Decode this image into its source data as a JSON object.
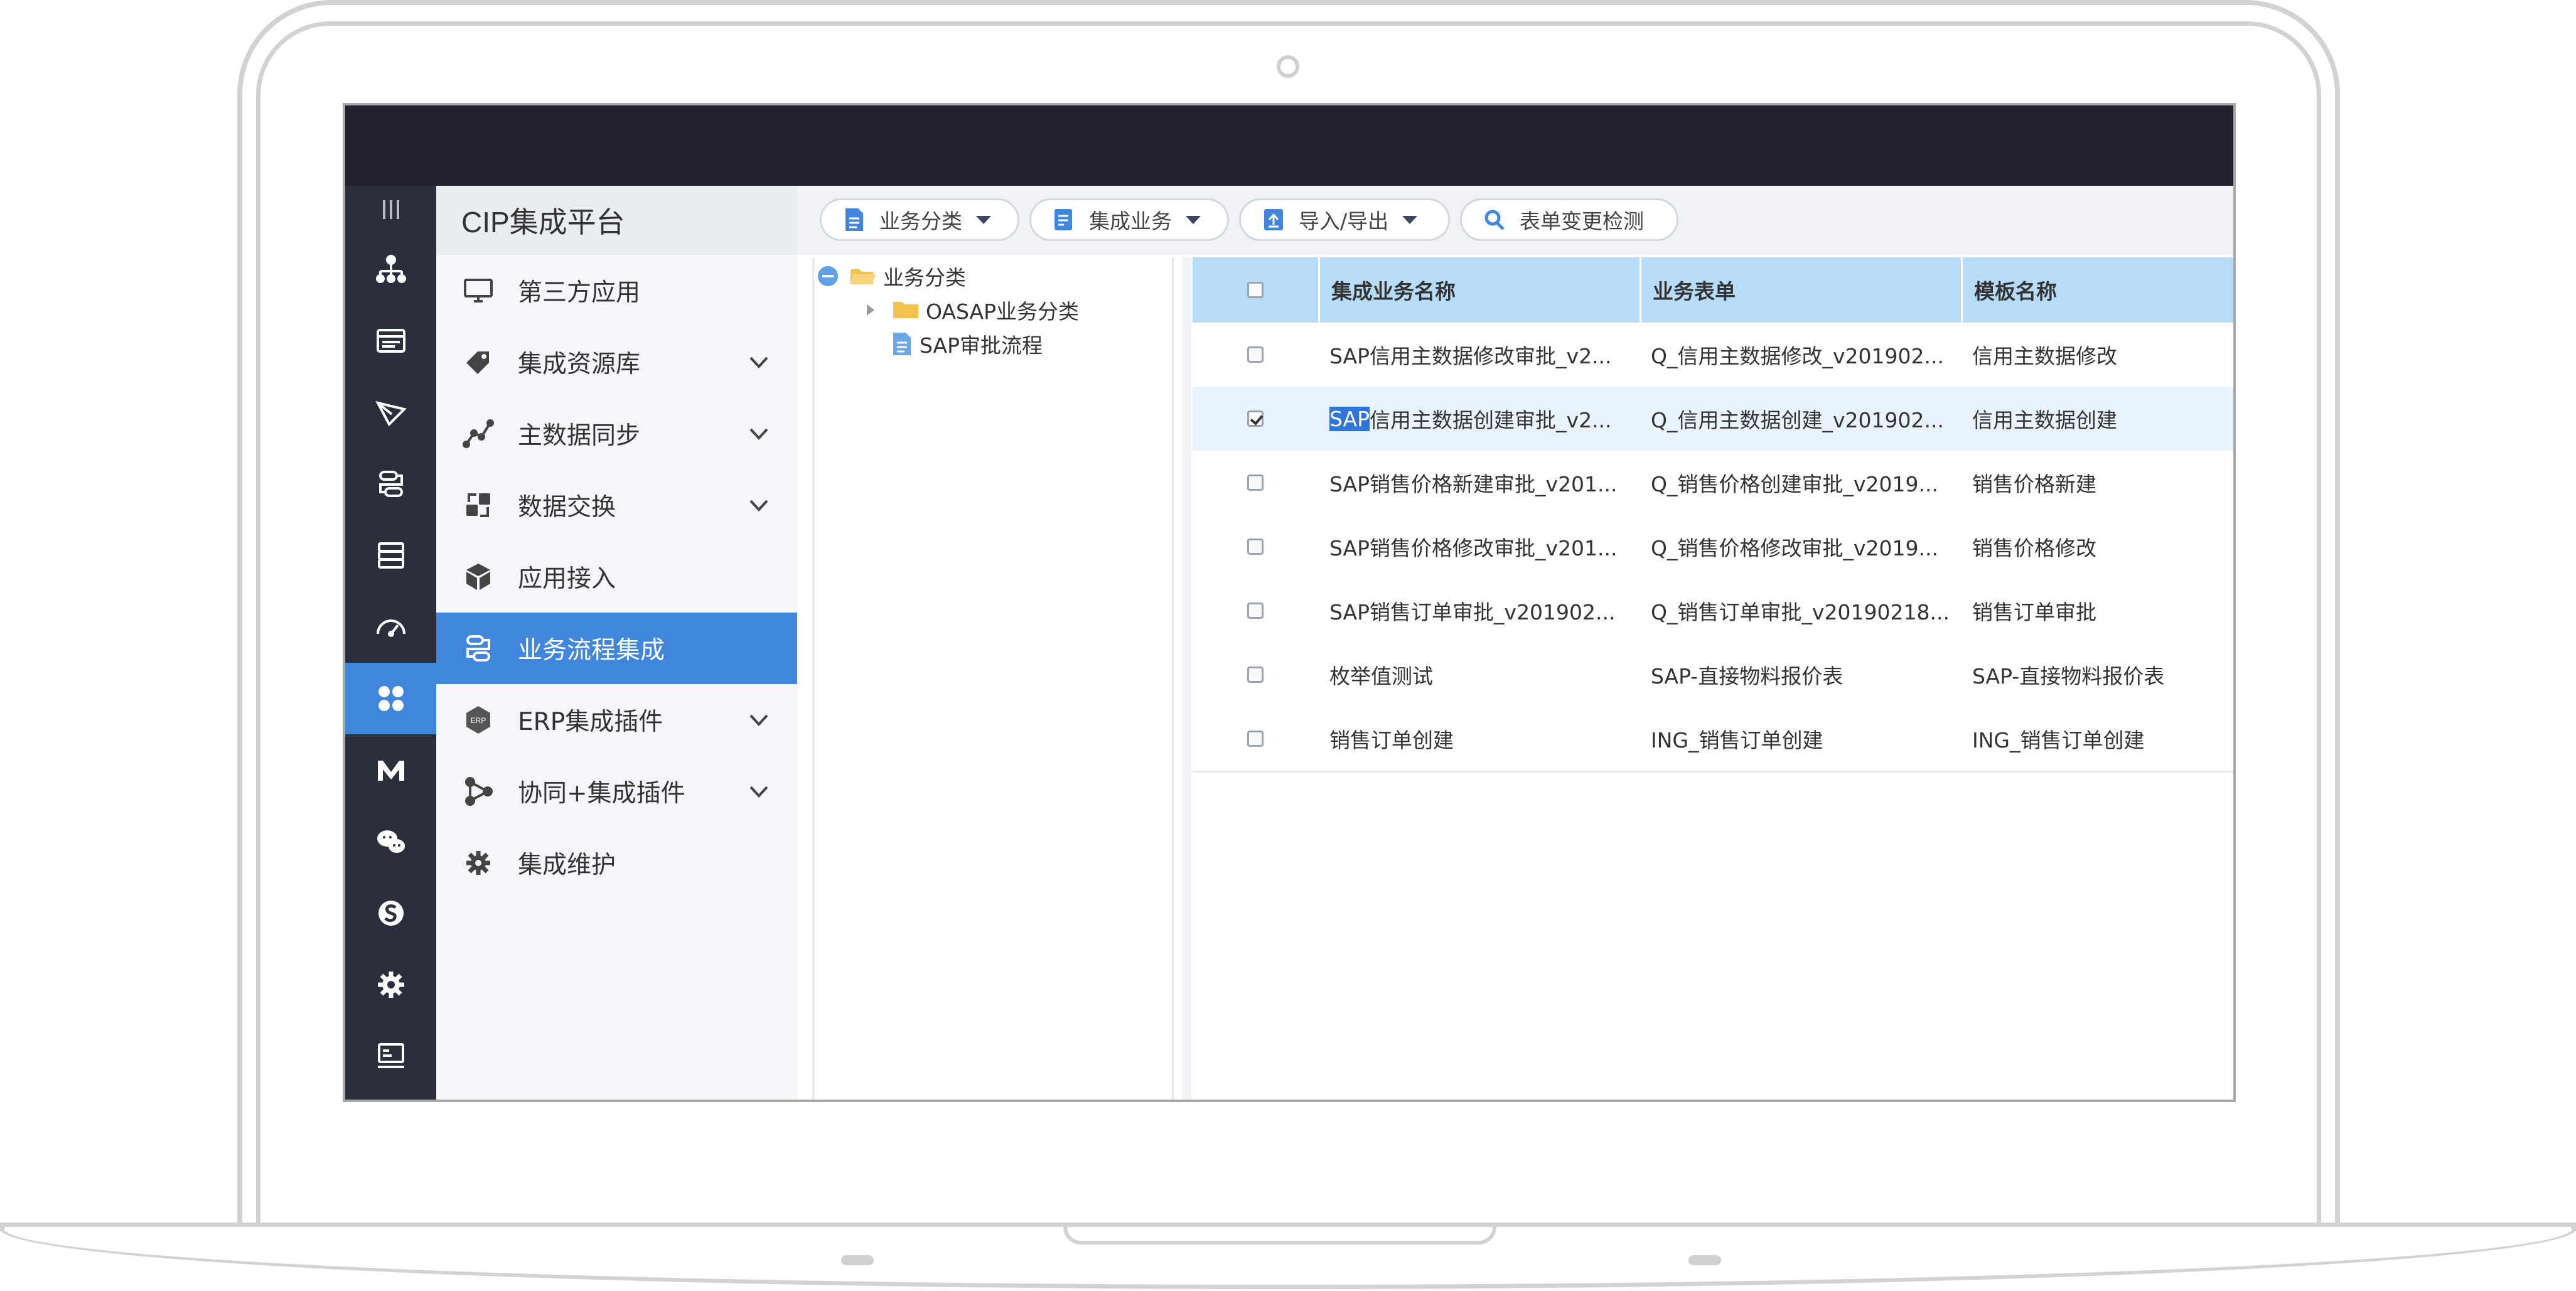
{
  "app": {
    "platform_title": "CIP集成平台"
  },
  "nav": {
    "items": [
      {
        "label": "第三方应用",
        "icon": "monitor-icon",
        "expandable": false
      },
      {
        "label": "集成资源库",
        "icon": "tag-icon",
        "expandable": true
      },
      {
        "label": "主数据同步",
        "icon": "line-chart-icon",
        "expandable": true
      },
      {
        "label": "数据交换",
        "icon": "exchange-icon",
        "expandable": true
      },
      {
        "label": "应用接入",
        "icon": "cube-icon",
        "expandable": false
      },
      {
        "label": "业务流程集成",
        "icon": "flow-icon",
        "expandable": false,
        "active": true
      },
      {
        "label": "ERP集成插件",
        "icon": "erp-icon",
        "expandable": true
      },
      {
        "label": "协同+集成插件",
        "icon": "share-icon",
        "expandable": true
      },
      {
        "label": "集成维护",
        "icon": "gear-icon",
        "expandable": false
      }
    ]
  },
  "toolbar": {
    "category_label": "业务分类",
    "integration_label": "集成业务",
    "import_export_label": "导入/导出",
    "form_check_label": "表单变更检测"
  },
  "tree": {
    "root_label": "业务分类",
    "child_folder_label": "OASAP业务分类",
    "child_leaf_label": "SAP审批流程"
  },
  "table": {
    "headers": {
      "name": "集成业务名称",
      "form": "业务表单",
      "template": "模板名称"
    },
    "rows": [
      {
        "name": "SAP信用主数据修改审批_v2...",
        "form": "Q_信用主数据修改_v201902...",
        "template": "信用主数据修改",
        "checked": false
      },
      {
        "name_highlight": "SAP",
        "name_rest": "信用主数据创建审批_v2...",
        "form": "Q_信用主数据创建_v201902...",
        "template": "信用主数据创建",
        "checked": true
      },
      {
        "name": "SAP销售价格新建审批_v201...",
        "form": "Q_销售价格创建审批_v2019...",
        "template": "销售价格新建",
        "checked": false
      },
      {
        "name": "SAP销售价格修改审批_v201...",
        "form": "Q_销售价格修改审批_v2019...",
        "template": "销售价格修改",
        "checked": false
      },
      {
        "name": "SAP销售订单审批_v201902...",
        "form": "Q_销售订单审批_v20190218...",
        "template": "销售订单审批",
        "checked": false
      },
      {
        "name": "枚举值测试",
        "form": "SAP-直接物料报价表",
        "template": "SAP-直接物料报价表",
        "checked": false
      },
      {
        "name": "销售订单创建",
        "form": "ING_销售订单创建",
        "template": "ING_销售订单创建",
        "checked": false
      }
    ]
  },
  "colors": {
    "accent": "#3f86dc",
    "topbar": "#22222e",
    "iconbar": "#2b2f3b",
    "table_header": "#b6dcf7"
  }
}
